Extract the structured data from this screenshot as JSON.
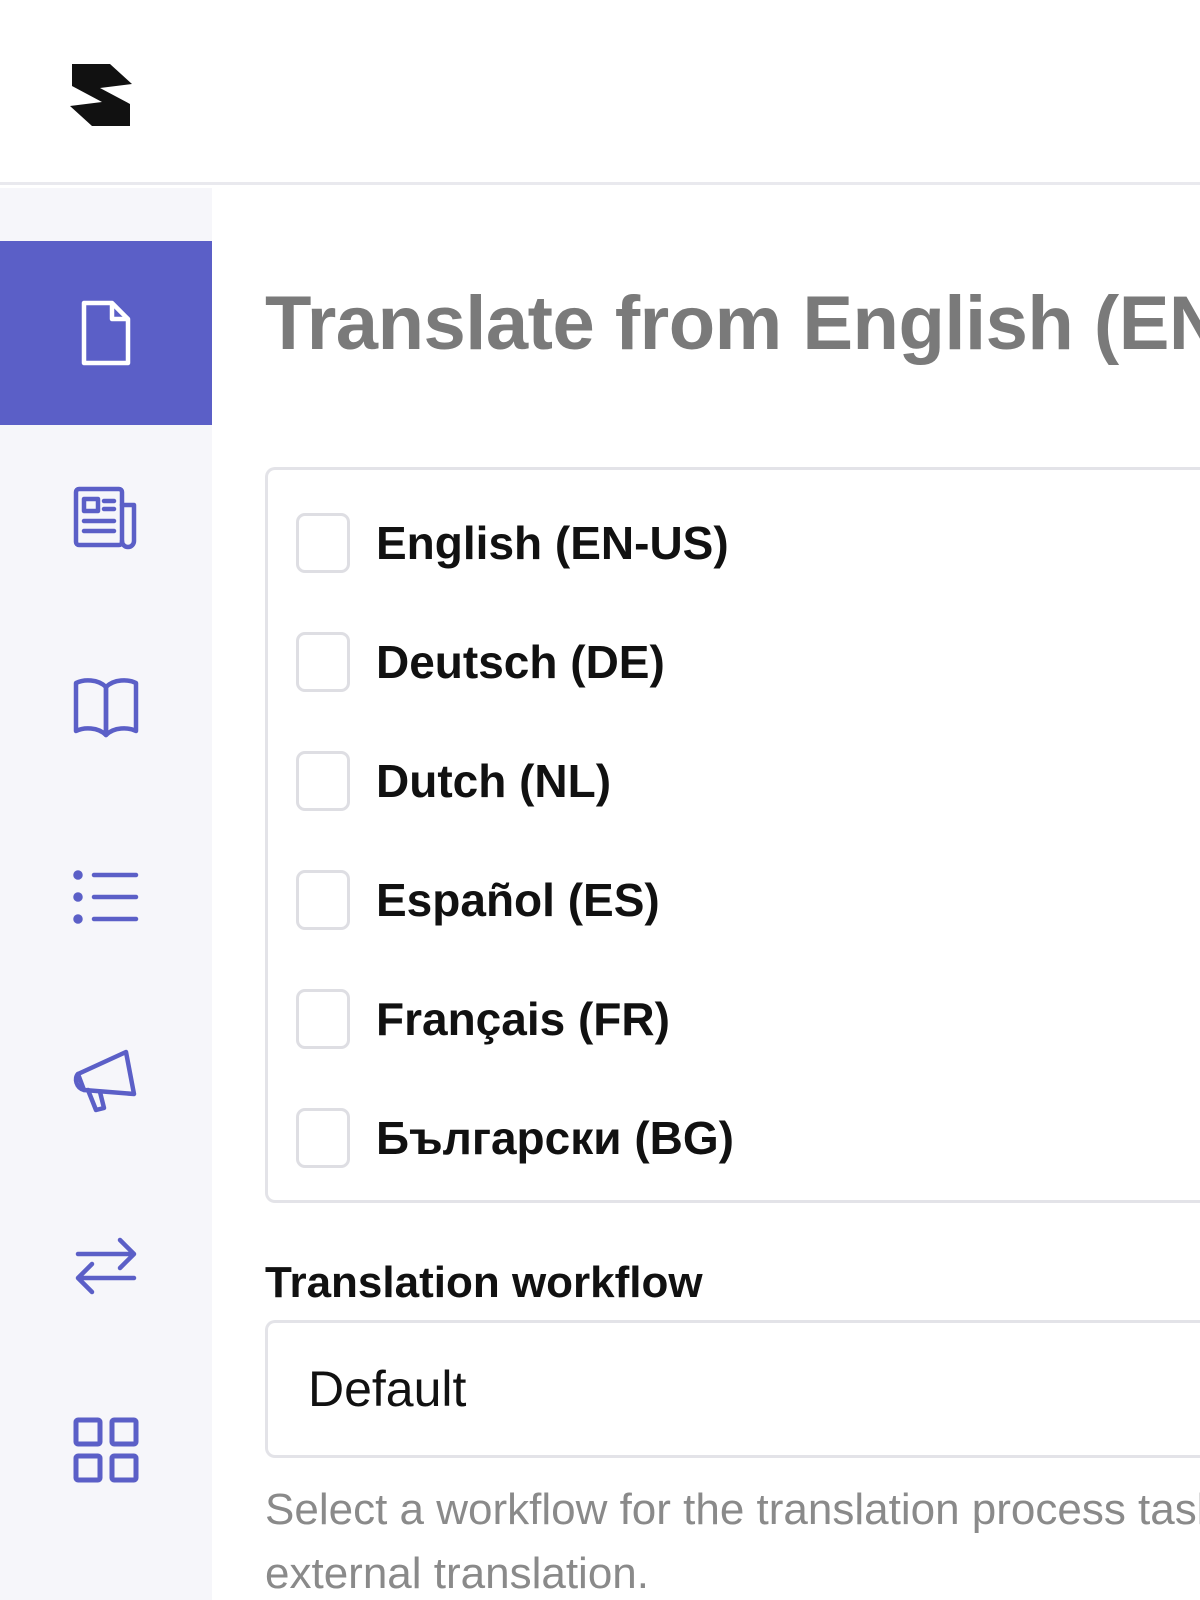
{
  "header": {
    "logo": "brand-logo-icon"
  },
  "sidebar": {
    "accent_color": "#5b5fc7",
    "items": [
      {
        "icon": "document-icon",
        "active": true
      },
      {
        "icon": "newspaper-icon",
        "active": false
      },
      {
        "icon": "book-icon",
        "active": false
      },
      {
        "icon": "list-icon",
        "active": false
      },
      {
        "icon": "megaphone-icon",
        "active": false
      },
      {
        "icon": "arrows-swap-icon",
        "active": false
      },
      {
        "icon": "grid-icon",
        "active": false
      }
    ]
  },
  "main": {
    "title": "Translate from English (EN",
    "languages": [
      {
        "label": "English (EN-US)",
        "checked": false
      },
      {
        "label": "Deutsch (DE)",
        "checked": false
      },
      {
        "label": "Dutch (NL)",
        "checked": false
      },
      {
        "label": "Español (ES)",
        "checked": false
      },
      {
        "label": "Français (FR)",
        "checked": false
      },
      {
        "label": "Български (BG)",
        "checked": false
      }
    ],
    "workflow": {
      "label": "Translation workflow",
      "value": "Default",
      "help": "Select a workflow for the translation process task for external translation."
    }
  }
}
